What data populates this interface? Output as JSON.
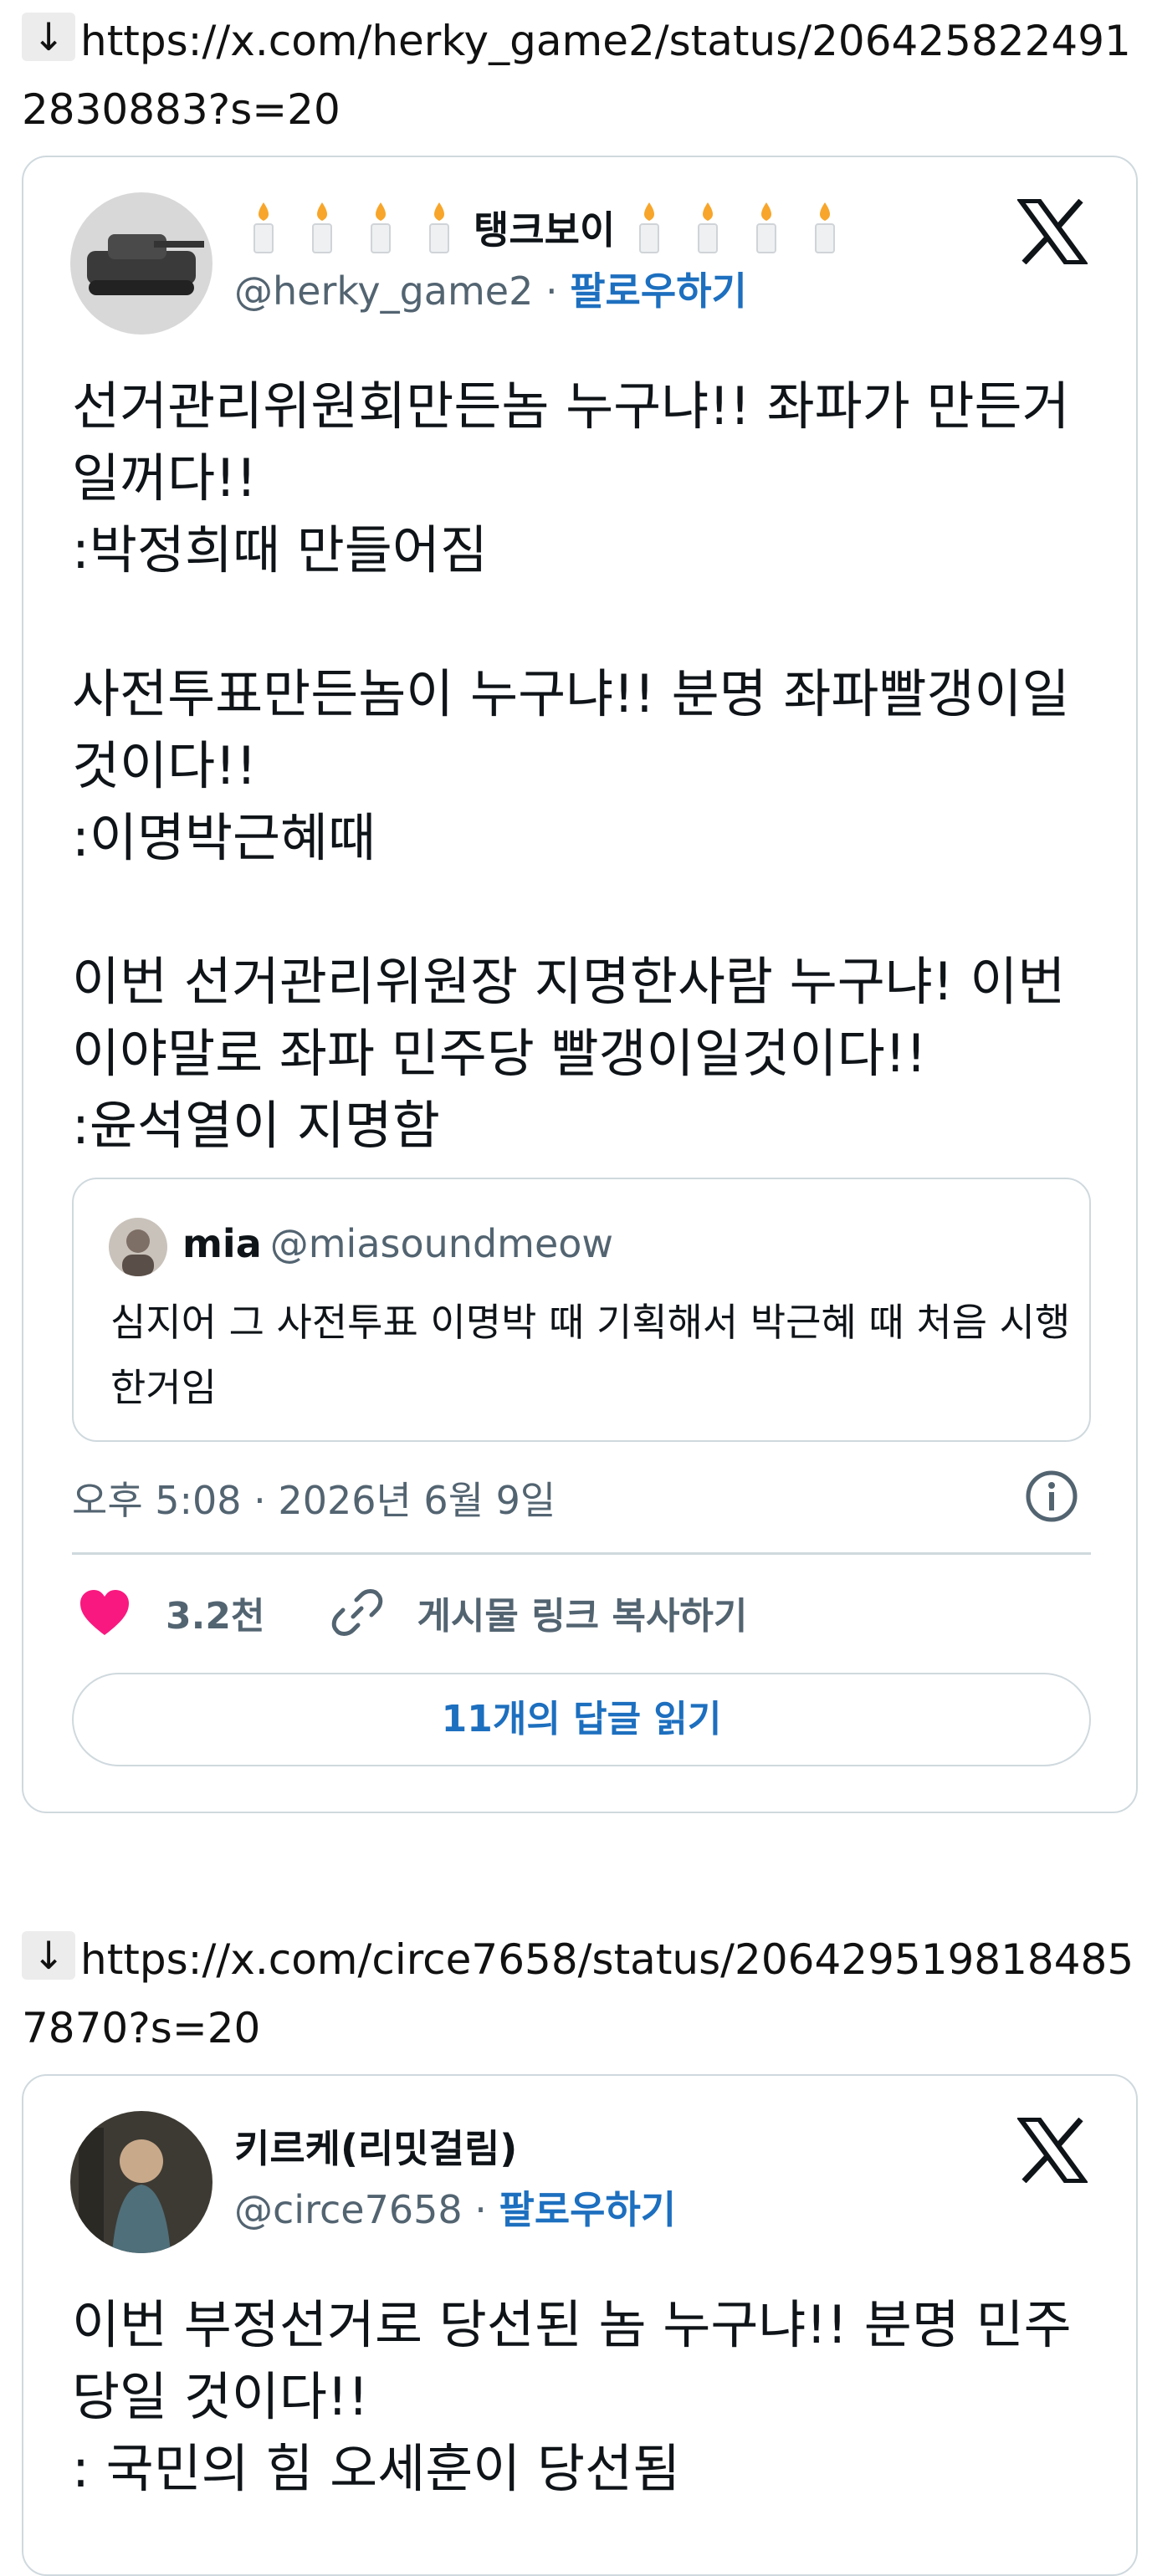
{
  "tweet1": {
    "link_arrow": "↓",
    "link_url": "https://x.com/herky_game2/status/2064258224912830883?s=20",
    "display_name": "탱크보이",
    "name_emoji": "🕯",
    "handle": "@herky_game2",
    "separator": "·",
    "follow_label": "팔로우하기",
    "paragraphs": [
      "선거관리위원회만든놈 누구냐!! 좌파가 만든거일꺼다!!",
      ":박정희때 만들어짐",
      "사전투표만든놈이 누구냐!! 분명 좌파빨갱이일것이다!!",
      ":이명박근혜때",
      "이번 선거관리위원장 지명한사람 누구냐! 이번이야말로 좌파 민주당 빨갱이일것이다!!",
      ":윤석열이 지명함"
    ],
    "quote": {
      "name": "mia",
      "handle": "@miasoundmeow",
      "text": "심지어 그 사전투표 이명박 때 기획해서 박근혜 때 처음 시행한거임"
    },
    "timestamp": "오후 5:08 · 2026년 6월 9일",
    "likes": "3.2천",
    "copy_link_label": "게시물 링크 복사하기",
    "read_replies_label": "11개의 답글 읽기"
  },
  "tweet2": {
    "link_arrow": "↓",
    "link_url": "https://x.com/circe7658/status/2064295198184857870?s=20",
    "display_name": "키르케(리밋걸림)",
    "handle": "@circe7658",
    "separator": "·",
    "follow_label": "팔로우하기",
    "paragraphs": [
      "이번 부정선거로 당선된 놈 누구냐!! 분명 민주당일 것이다!!",
      ": 국민의 힘 오세훈이 당선됨"
    ]
  },
  "colors": {
    "follow": "#1d6fbf",
    "border": "#cfd9de",
    "muted": "#536471",
    "heart": "#f91880"
  }
}
